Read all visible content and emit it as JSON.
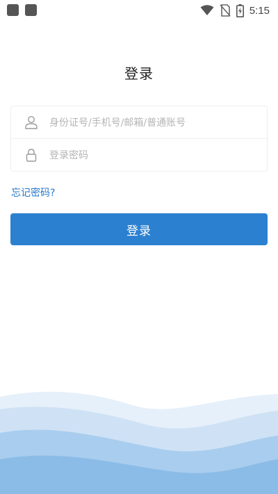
{
  "status_bar": {
    "time": "5:15",
    "icons": [
      "app-square-icon",
      "app-square-icon",
      "wifi-icon",
      "no-sim-icon",
      "battery-charging-icon"
    ]
  },
  "page": {
    "title": "登录"
  },
  "form": {
    "username": {
      "placeholder": "身份证号/手机号/邮箱/普通账号",
      "value": "",
      "icon": "user-icon"
    },
    "password": {
      "placeholder": "登录密码",
      "value": "",
      "icon": "lock-icon"
    }
  },
  "links": {
    "forgot_password": "忘记密码?"
  },
  "actions": {
    "login_label": "登录"
  },
  "colors": {
    "accent": "#2c80d0",
    "link": "#2777c9",
    "wave_light": "#d6e8f7",
    "wave_mid": "#a9cdee",
    "wave_dark": "#7fb3e3"
  }
}
